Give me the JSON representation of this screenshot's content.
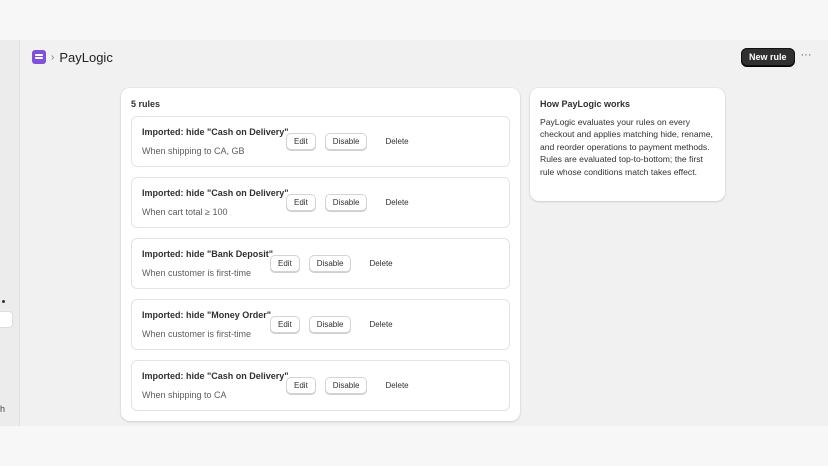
{
  "header": {
    "app_name": "PayLogic",
    "chevron": "›",
    "new_rule_label": "New rule",
    "more_label": "···"
  },
  "rules_card": {
    "count_label": "5 rules"
  },
  "rules": [
    {
      "title": "Imported: hide \"Cash on Delivery\"",
      "condition": "When shipping to CA, GB"
    },
    {
      "title": "Imported: hide \"Cash on Delivery\"",
      "condition": "When cart total ≥ 100"
    },
    {
      "title": "Imported: hide \"Bank Deposit\"",
      "condition": "When customer is first-time"
    },
    {
      "title": "Imported: hide \"Money Order\"",
      "condition": "When customer is first-time"
    },
    {
      "title": "Imported: hide \"Cash on Delivery\"",
      "condition": "When shipping to CA"
    }
  ],
  "actions": {
    "edit": "Edit",
    "disable": "Disable",
    "delete": "Delete"
  },
  "info": {
    "title": "How PayLogic works",
    "body": "PayLogic evaluates your rules on every checkout and applies matching hide, rename, and reorder operations to payment methods. Rules are evaluated top-to-bottom; the first rule whose conditions match takes effect."
  },
  "left_rail": {
    "fragment": "h"
  },
  "colors": {
    "accent": "#8051d8",
    "primary_button": "#303030"
  }
}
